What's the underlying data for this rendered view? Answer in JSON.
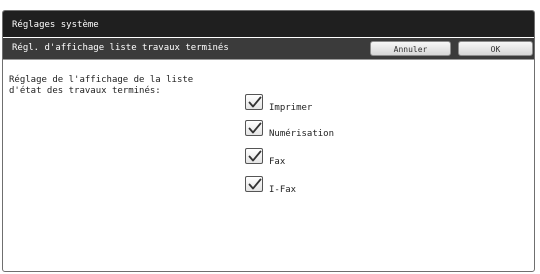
{
  "window": {
    "title": "Réglages système"
  },
  "subheader": {
    "title": "Régl. d'affichage liste travaux terminés",
    "cancel_label": "Annuler",
    "ok_label": "OK"
  },
  "setting": {
    "label": "Réglage de l'affichage de la liste\nd'état des travaux terminés:",
    "options": [
      {
        "label": "Imprimer",
        "checked": true
      },
      {
        "label": "Numérisation",
        "checked": true
      },
      {
        "label": "Fax",
        "checked": true
      },
      {
        "label": "I-Fax",
        "checked": true
      }
    ]
  },
  "colors": {
    "titlebar": "#1f1f1f",
    "subheader": "#3b3b3b",
    "button_bg": "#e6e6e6",
    "frame_border": "#6f6f6f"
  },
  "icons": {
    "check": "check-icon"
  }
}
